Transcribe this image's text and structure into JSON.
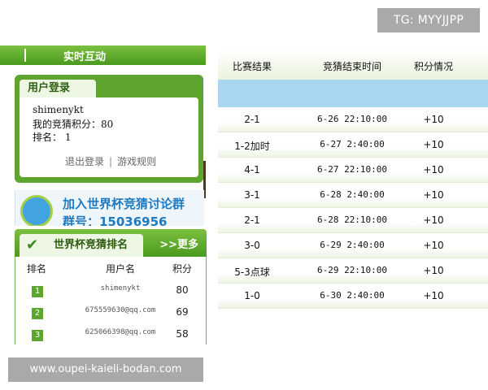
{
  "watermarks": {
    "tg": "TG: MYYJJPP",
    "url": "www.oupei-kaieli-bodan.com"
  },
  "left_panel": {
    "interact_title": "实时互动",
    "login": {
      "tab": "用户登录",
      "username": "shimenykt",
      "points_line": "我的竞猜积分：80",
      "rank_line": "排名：  1",
      "logout": "退出登录",
      "separator": "|",
      "rules": "游戏规则"
    },
    "ad": {
      "line1": "加入世界杯竞猜讨论群",
      "line2": "群号：15036956",
      "icon": "qq-penguin-icon"
    },
    "ranking": {
      "title": "世界杯竞猜排名",
      "more": ">>更多",
      "headers": [
        "排名",
        "用户名",
        "积分"
      ],
      "rows": [
        {
          "rank": "1",
          "user": "shimenykt",
          "points": "80"
        },
        {
          "rank": "2",
          "user": "675559630@qq.com",
          "points": "69"
        },
        {
          "rank": "3",
          "user": "625066398@qq.com",
          "points": "58"
        }
      ]
    }
  },
  "results_table": {
    "headers": [
      "比赛结果",
      "竞猜结束时间",
      "积分情况"
    ],
    "rows": [
      {
        "result": "2-1",
        "end_time": "6-26 22:10:00",
        "points": "+10"
      },
      {
        "result": "1-2加时",
        "end_time": "6-27 2:40:00",
        "points": "+10"
      },
      {
        "result": "4-1",
        "end_time": "6-27 22:10:00",
        "points": "+10"
      },
      {
        "result": "3-1",
        "end_time": "6-28 2:40:00",
        "points": "+10"
      },
      {
        "result": "2-1",
        "end_time": "6-28 22:10:00",
        "points": "+10"
      },
      {
        "result": "3-0",
        "end_time": "6-29 2:40:00",
        "points": "+10"
      },
      {
        "result": "5-3点球",
        "end_time": "6-29 22:10:00",
        "points": "+10"
      },
      {
        "result": "1-0",
        "end_time": "6-30 2:40:00",
        "points": "+10"
      }
    ]
  },
  "colors": {
    "green": "#5ea52f",
    "light_blue": "#a9d6f0",
    "watermark_gray": "#a9a9a9"
  }
}
